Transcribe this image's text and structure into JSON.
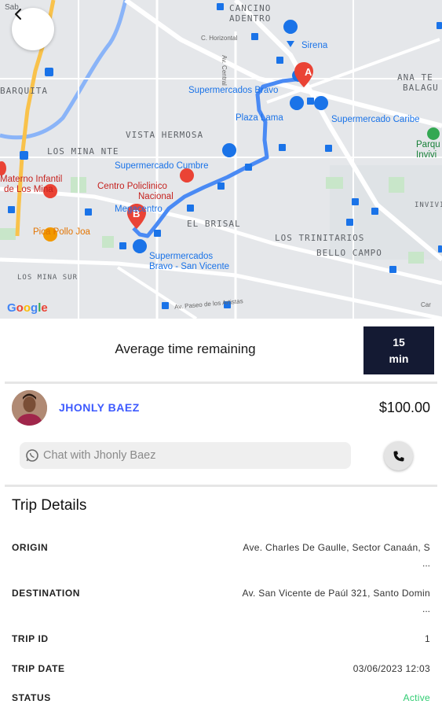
{
  "map": {
    "neighborhoods": {
      "cancino_line1": "CANCINO",
      "cancino_line2": "ADENTRO",
      "ana_te_line1": "ANA TE",
      "ana_te_line2": "BALAGU",
      "barquita": "BARQUITA",
      "vista_hermosa": "VISTA HERMOSA",
      "los_mina_nte": "LOS MINA NTE",
      "el_brisal": "EL BRISAL",
      "los_trinitarios": "LOS TRINITARIOS",
      "bello_campo": "BELLO CAMPO",
      "los_mina_sur": "LOS MINA SUR",
      "invivi": "INVIVI",
      "sab": "Sab",
      "parq_line1": "Parqu",
      "parq_line2": "Invivi"
    },
    "pois": {
      "sirena": "Sirena",
      "supermercados_bravo": "Supermercados Bravo",
      "plaza_lama": "Plaza Lama",
      "supermercado_caribe": "Supermercado Caribe",
      "supermercado_cumbre": "Supermercado Cumbre",
      "centro_policlinico_line1": "Centro Policlinico",
      "centro_policlinico_line2": "Nacional",
      "megacentro": "Megacentro",
      "materno_line1": "Materno Infantil",
      "materno_line2": "de Los Mina",
      "pica_pollo": "Pica Pollo Joa",
      "bravo_sv_line1": "Supermercados",
      "bravo_sv_line2": "Bravo - San Vicente"
    },
    "roads": {
      "horizontal": "C. Horizontal",
      "central": "Av. Central",
      "paseo": "Av. Paseo de los Artistas",
      "car": "Car"
    },
    "markers": {
      "origin": "A",
      "destination": "B"
    },
    "google_logo": [
      "G",
      "o",
      "o",
      "g",
      "l",
      "e"
    ],
    "colors": {
      "route": "#4a8af4",
      "pin": "#ea4335",
      "poi_blue": "#1a73e8"
    },
    "back_icon": "chevron-left-icon"
  },
  "eta": {
    "label": "Average time remaining",
    "value": "15",
    "unit": "min"
  },
  "driver": {
    "name": "JHONLY BAEZ",
    "price": "$100.00",
    "chat_placeholder": "Chat with Jhonly Baez",
    "chat_icon": "whatsapp-icon",
    "call_icon": "phone-icon"
  },
  "trip": {
    "title": "Trip Details",
    "origin": {
      "label": "ORIGIN",
      "value": "Ave. Charles De Gaulle, Sector Canaán, S",
      "more": "..."
    },
    "destination": {
      "label": "DESTINATION",
      "value": "Av. San Vicente de Paúl 321, Santo Domin",
      "more": "..."
    },
    "trip_id": {
      "label": "TRIP ID",
      "value": "1"
    },
    "trip_date": {
      "label": "TRIP DATE",
      "value": "03/06/2023 12:03"
    },
    "status": {
      "label": "STATUS",
      "value": "Active",
      "color": "#2ecc71"
    }
  }
}
